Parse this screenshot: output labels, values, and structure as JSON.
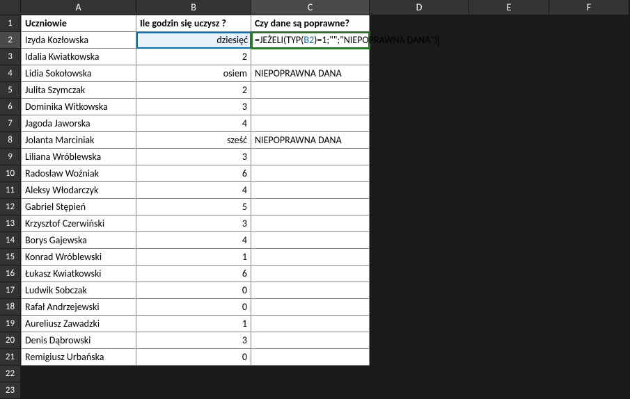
{
  "columns": [
    "A",
    "B",
    "C",
    "D",
    "E",
    "F"
  ],
  "rowCount": 23,
  "headers": {
    "A": "Uczniowie",
    "B": "Ile godzin się uczysz ?",
    "C": "Czy dane są poprawne?"
  },
  "editingCell": {
    "row": 2,
    "col": "C",
    "formula_pre": "=JEŻELI(TYP(",
    "formula_ref": "B2",
    "formula_post": ")=1;\"\";\"NIEPOPRAWNA DANA\")"
  },
  "rows": [
    {
      "a": "Izyda Kozłowska",
      "b": "dziesięć",
      "c": ""
    },
    {
      "a": "Idalia Kwiatkowska",
      "b": "2",
      "c": ""
    },
    {
      "a": "Lidia Sokołowska",
      "b": "osiem",
      "c": "NIEPOPRAWNA DANA"
    },
    {
      "a": "Julita Szymczak",
      "b": "2",
      "c": ""
    },
    {
      "a": "Dominika Witkowska",
      "b": "3",
      "c": ""
    },
    {
      "a": "Jagoda Jaworska",
      "b": "4",
      "c": ""
    },
    {
      "a": "Jolanta Marciniak",
      "b": "sześć",
      "c": "NIEPOPRAWNA DANA"
    },
    {
      "a": "Liliana Wróblewska",
      "b": "3",
      "c": ""
    },
    {
      "a": "Radosław Woźniak",
      "b": "6",
      "c": ""
    },
    {
      "a": "Aleksy Włodarczyk",
      "b": "4",
      "c": ""
    },
    {
      "a": "Gabriel Stępień",
      "b": "5",
      "c": ""
    },
    {
      "a": "Krzysztof Czerwiński",
      "b": "3",
      "c": ""
    },
    {
      "a": "Borys Gajewska",
      "b": "4",
      "c": ""
    },
    {
      "a": "Konrad Wróblewski",
      "b": "1",
      "c": ""
    },
    {
      "a": "Łukasz Kwiatkowski",
      "b": "6",
      "c": ""
    },
    {
      "a": "Ludwik Sobczak",
      "b": "0",
      "c": ""
    },
    {
      "a": "Rafał Andrzejewski",
      "b": "0",
      "c": ""
    },
    {
      "a": "Aureliusz Zawadzki",
      "b": "1",
      "c": ""
    },
    {
      "a": "Denis Dąbrowski",
      "b": "3",
      "c": ""
    },
    {
      "a": "Remigiusz Urbańska",
      "b": "0",
      "c": ""
    }
  ]
}
